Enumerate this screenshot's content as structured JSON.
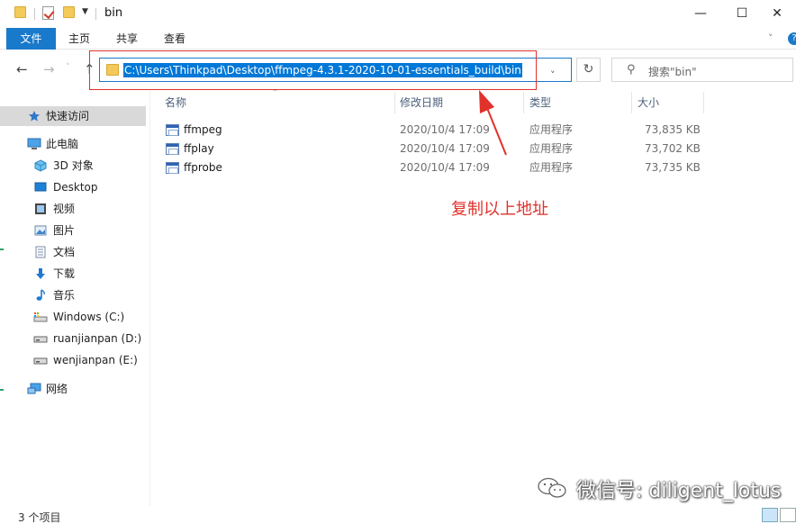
{
  "window": {
    "title": "bin",
    "minimize": "—",
    "maximize": "☐",
    "close": "✕"
  },
  "ribbon": {
    "tabs": [
      {
        "label": "文件",
        "active": true
      },
      {
        "label": "主页"
      },
      {
        "label": "共享"
      },
      {
        "label": "查看"
      }
    ]
  },
  "address": {
    "path": "C:\\Users\\Thinkpad\\Desktop\\ffmpeg-4.3.1-2020-10-01-essentials_build\\bin",
    "search_placeholder": "搜索\"bin\""
  },
  "sidebar": {
    "items": [
      {
        "label": "快速访问",
        "icon": "star-icon",
        "selected": true
      },
      {
        "label": "此电脑",
        "icon": "computer-icon"
      },
      {
        "label": "3D 对象",
        "icon": "cube-3d-icon"
      },
      {
        "label": "Desktop",
        "icon": "desktop-icon"
      },
      {
        "label": "视频",
        "icon": "video-icon"
      },
      {
        "label": "图片",
        "icon": "picture-icon"
      },
      {
        "label": "文档",
        "icon": "document-icon"
      },
      {
        "label": "下载",
        "icon": "download-icon"
      },
      {
        "label": "音乐",
        "icon": "music-icon"
      },
      {
        "label": "Windows (C:)",
        "icon": "system-drive-icon"
      },
      {
        "label": "ruanjianpan (D:)",
        "icon": "drive-icon"
      },
      {
        "label": "wenjianpan (E:)",
        "icon": "drive-icon"
      },
      {
        "label": "网络",
        "icon": "network-icon"
      }
    ]
  },
  "list": {
    "columns": [
      "名称",
      "修改日期",
      "类型",
      "大小"
    ],
    "files": [
      {
        "name": "ffmpeg",
        "date": "2020/10/4 17:09",
        "type": "应用程序",
        "size": "73,835 KB"
      },
      {
        "name": "ffplay",
        "date": "2020/10/4 17:09",
        "type": "应用程序",
        "size": "73,702 KB"
      },
      {
        "name": "ffprobe",
        "date": "2020/10/4 17:09",
        "type": "应用程序",
        "size": "73,735 KB"
      }
    ]
  },
  "annotation": {
    "text": "复制以上地址",
    "color": "#e0312b"
  },
  "watermark": {
    "text": "微信号: diligent_lotus"
  },
  "status": {
    "item_count": "3 个项目"
  },
  "colors": {
    "accent": "#1979ca",
    "selection": "#0078d7"
  }
}
